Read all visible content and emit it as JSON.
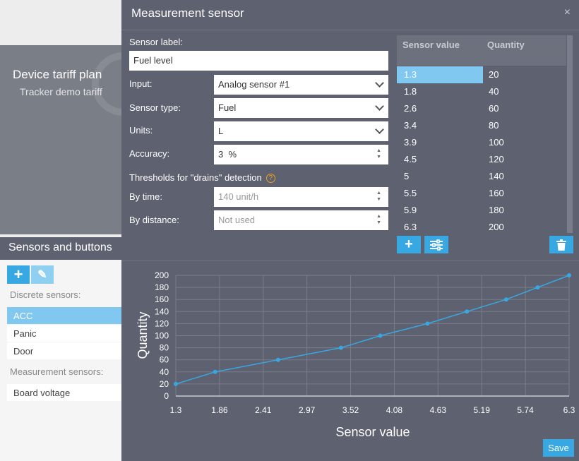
{
  "background": {
    "tariff_title": "Device tariff plan",
    "tariff_subtitle": "Tracker demo tariff",
    "sidebar_title": "Sensors and buttons",
    "discrete_label": "Discrete sensors:",
    "discrete_items": [
      "ACC",
      "Panic",
      "Door"
    ],
    "measurement_label": "Measurement sensors:",
    "measurement_items": [
      "Board voltage"
    ]
  },
  "modal": {
    "title": "Measurement sensor",
    "close_icon": "×",
    "sensor_label_label": "Sensor label:",
    "sensor_label_value": "Fuel level",
    "input_label": "Input:",
    "input_value": "Analog sensor #1",
    "sensor_type_label": "Sensor type:",
    "sensor_type_value": "Fuel",
    "units_label": "Units:",
    "units_value": "L",
    "accuracy_label": "Accuracy:",
    "accuracy_value": "3  %",
    "thresholds_label": "Thresholds for \"drains\" detection",
    "by_time_label": "By time:",
    "by_time_placeholder": "140 unit/h",
    "by_distance_label": "By distance:",
    "by_distance_placeholder": "Not used",
    "save_label": "Save"
  },
  "table": {
    "col1": "Sensor value",
    "col2": "Quantity",
    "rows": [
      {
        "v": "1.3",
        "q": "20"
      },
      {
        "v": "1.8",
        "q": "40"
      },
      {
        "v": "2.6",
        "q": "60"
      },
      {
        "v": "3.4",
        "q": "80"
      },
      {
        "v": "3.9",
        "q": "100"
      },
      {
        "v": "4.5",
        "q": "120"
      },
      {
        "v": "5",
        "q": "140"
      },
      {
        "v": "5.5",
        "q": "160"
      },
      {
        "v": "5.9",
        "q": "180"
      },
      {
        "v": "6.3",
        "q": "200"
      }
    ]
  },
  "colors": {
    "accent": "#38a8e3",
    "modal_bg": "#5d6170",
    "selected": "#80c8f0"
  },
  "chart_data": {
    "type": "line",
    "xlabel": "Sensor value",
    "ylabel": "Quantity",
    "x": [
      1.3,
      1.8,
      2.6,
      3.4,
      3.9,
      4.5,
      5,
      5.5,
      5.9,
      6.3
    ],
    "y": [
      20,
      40,
      60,
      80,
      100,
      120,
      140,
      160,
      180,
      200
    ],
    "xlim": [
      1.3,
      6.3
    ],
    "ylim": [
      0,
      200
    ],
    "xticks": [
      "1.3",
      "1.86",
      "2.41",
      "2.97",
      "3.52",
      "4.08",
      "4.63",
      "5.19",
      "5.74",
      "6.3"
    ],
    "yticks": [
      "0",
      "20",
      "40",
      "60",
      "80",
      "100",
      "120",
      "140",
      "160",
      "180",
      "200"
    ],
    "grid": true,
    "color": "#38a8e3"
  }
}
